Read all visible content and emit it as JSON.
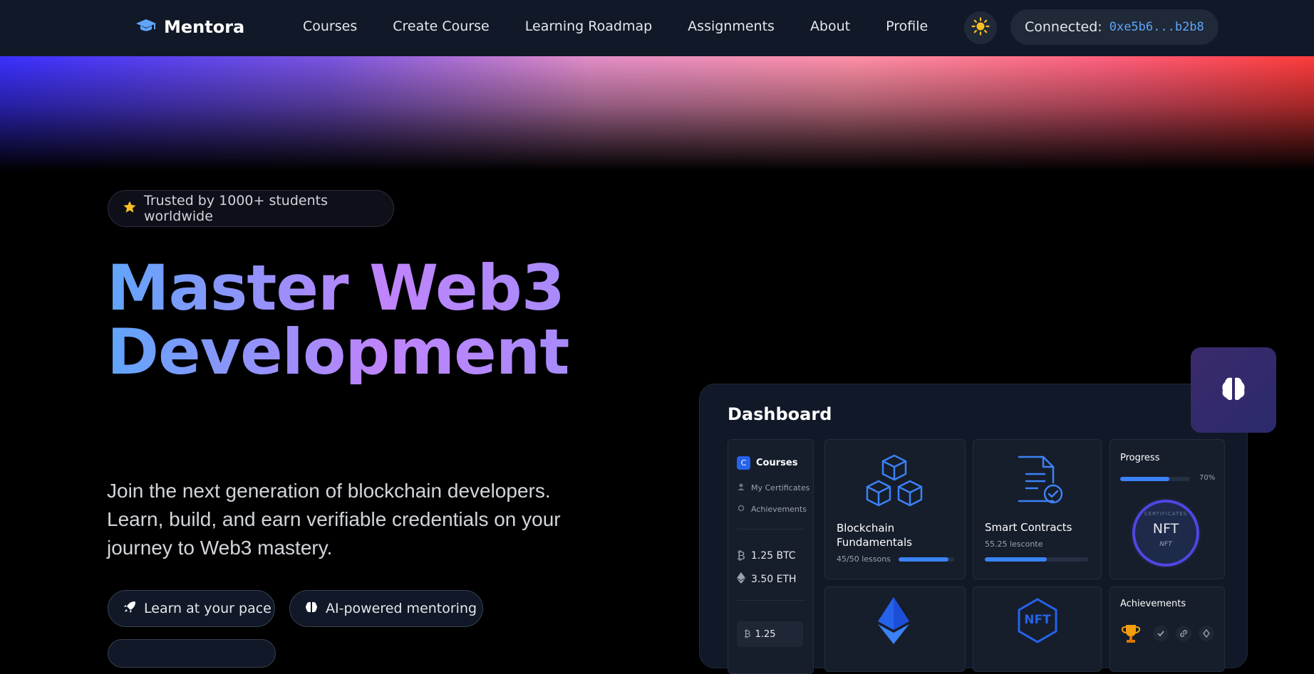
{
  "nav": {
    "brand": "Mentora",
    "links": [
      "Courses",
      "Create Course",
      "Learning Roadmap",
      "Assignments",
      "About",
      "Profile"
    ],
    "wallet_label": "Connected:",
    "wallet_address": "0xe5b6...b2b8"
  },
  "hero": {
    "badge": "Trusted by 1000+ students worldwide",
    "title_line1": "Master Web3",
    "title_line2": "Development",
    "subtitle": "Join the next generation of blockchain developers. Learn, build, and earn verifiable credentials on your journey to Web3 mastery.",
    "pills": [
      "Learn at your pace",
      "AI-powered mentoring"
    ]
  },
  "dashboard": {
    "title": "Dashboard",
    "sidebar": {
      "header": "Courses",
      "header_icon_letter": "C",
      "items": [
        "My Certificates",
        "Achievements"
      ],
      "btc": "1.25 BTC",
      "eth": "3.50 ETH",
      "mini_value": "1.25"
    },
    "cards": [
      {
        "title": "Blockchain Fundamentals",
        "meta": "45/50 lessons",
        "progress": 0.9
      },
      {
        "title": "Smart Contracts",
        "meta": "55.25 lesconte",
        "progress": 0.6
      }
    ],
    "progress_card": {
      "title": "Progress",
      "percent_label": "70%",
      "percent": 0.7,
      "nft_ring_text": "CERTIFICATES",
      "nft_main": "NFT",
      "nft_sub": "NFT"
    },
    "achievements": {
      "title": "Achievements"
    },
    "nft_hex_label": "NFT"
  },
  "colors": {
    "accent": "#3b82f6",
    "nav_bg": "#111827",
    "star": "#fbbf24"
  }
}
